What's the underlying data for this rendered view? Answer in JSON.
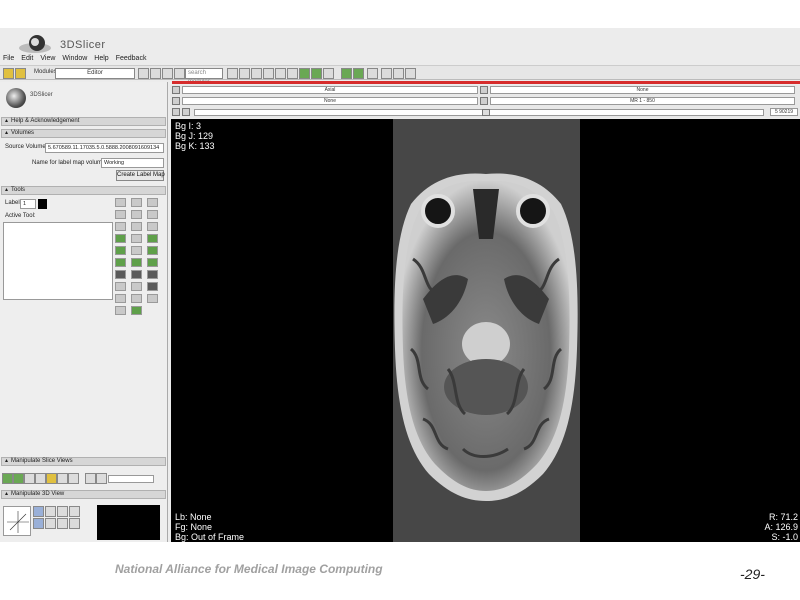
{
  "app": {
    "logo_text": "3DSlicer"
  },
  "menu": [
    "File",
    "Edit",
    "View",
    "Window",
    "Help",
    "Feedback"
  ],
  "toolbar": {
    "modules_label": "Modules",
    "module_selected": "Editor",
    "search_placeholder": "search modules"
  },
  "left_panel": {
    "logo_text": "3DSlicer",
    "help_section": "Help & Acknowledgement",
    "volumes_section": "Volumes",
    "source_volume_label": "Source Volume:",
    "source_volume_value": "5.670589.11.17035.5.0.5888.2008091609134",
    "label_map_name_label": "Name for label map volume:",
    "label_map_name_value": "Working",
    "create_label_map_button": "Create Label Map",
    "tools_section": "Tools",
    "label_label": "Label",
    "label_value": "1",
    "active_tool_label": "Active Tool:",
    "manipulate_slice_section": "Manipulate Slice Views",
    "manipulate_3d_section": "Manipulate 3D View"
  },
  "viewer": {
    "orientation": "Axial",
    "foreground": "None",
    "label": "None",
    "background": "MR 1 - 850",
    "slice_value": "5 90219",
    "overlay": {
      "bg_i": "Bg I: 3",
      "bg_j": "Bg J: 129",
      "bg_k": "Bg K: 133",
      "lb": "Lb: None",
      "fg": "Fg: None",
      "bg": "Bg: Out of Frame",
      "r": "R: 71.2",
      "a": "A: 126.9",
      "s": "S: -1.0"
    }
  },
  "footer": {
    "org": "National Alliance for Medical Image Computing",
    "page": "-29-"
  },
  "colors": {
    "accent_bar": "#d62c2c",
    "label_swatch": "#000000"
  }
}
